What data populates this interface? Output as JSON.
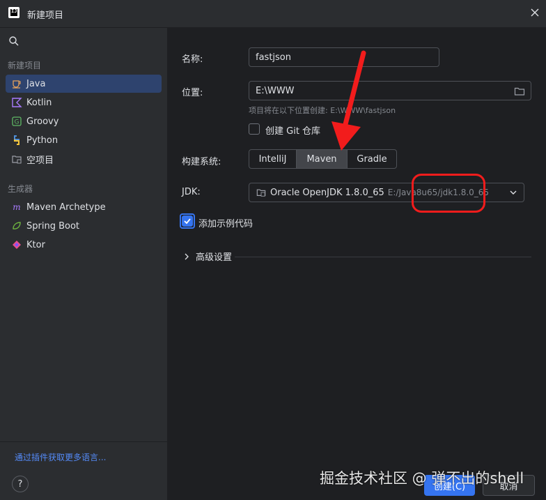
{
  "window": {
    "title": "新建项目"
  },
  "sidebar": {
    "section_new": "新建项目",
    "items": [
      {
        "label": "Java",
        "icon": "java-cup-icon"
      },
      {
        "label": "Kotlin",
        "icon": "kotlin-icon"
      },
      {
        "label": "Groovy",
        "icon": "groovy-icon"
      },
      {
        "label": "Python",
        "icon": "python-icon"
      },
      {
        "label": "空项目",
        "icon": "empty-project-icon"
      }
    ],
    "section_generators": "生成器",
    "generators": [
      {
        "label": "Maven Archetype",
        "icon": "maven-icon"
      },
      {
        "label": "Spring Boot",
        "icon": "spring-boot-icon"
      },
      {
        "label": "Ktor",
        "icon": "ktor-icon"
      }
    ],
    "plugins_link": "通过插件获取更多语言...",
    "help_label": "?"
  },
  "form": {
    "name_label": "名称:",
    "name_value": "fastjson",
    "location_label": "位置:",
    "location_value": "E:\\WWW",
    "location_hint": "项目将在以下位置创建: E:\\WWW\\fastjson",
    "git_label": "创建 Git 仓库",
    "git_checked": false,
    "build_label": "构建系统:",
    "build_options": [
      "IntelliJ",
      "Maven",
      "Gradle"
    ],
    "build_selected": "Maven",
    "jdk_label": "JDK:",
    "jdk_value": "Oracle OpenJDK 1.8.0_65",
    "jdk_path": "E:/Java8u65/jdk1.8.0_65",
    "sample_label": "添加示例代码",
    "sample_checked": true,
    "advanced_label": "高级设置"
  },
  "buttons": {
    "create": "创建(C)",
    "cancel": "取消"
  },
  "watermark": "掘金技术社区 @ 弹不出的shell",
  "colors": {
    "accent": "#3574f0",
    "annotation_red": "#f21c1c",
    "selected_bg": "#2e436e"
  }
}
